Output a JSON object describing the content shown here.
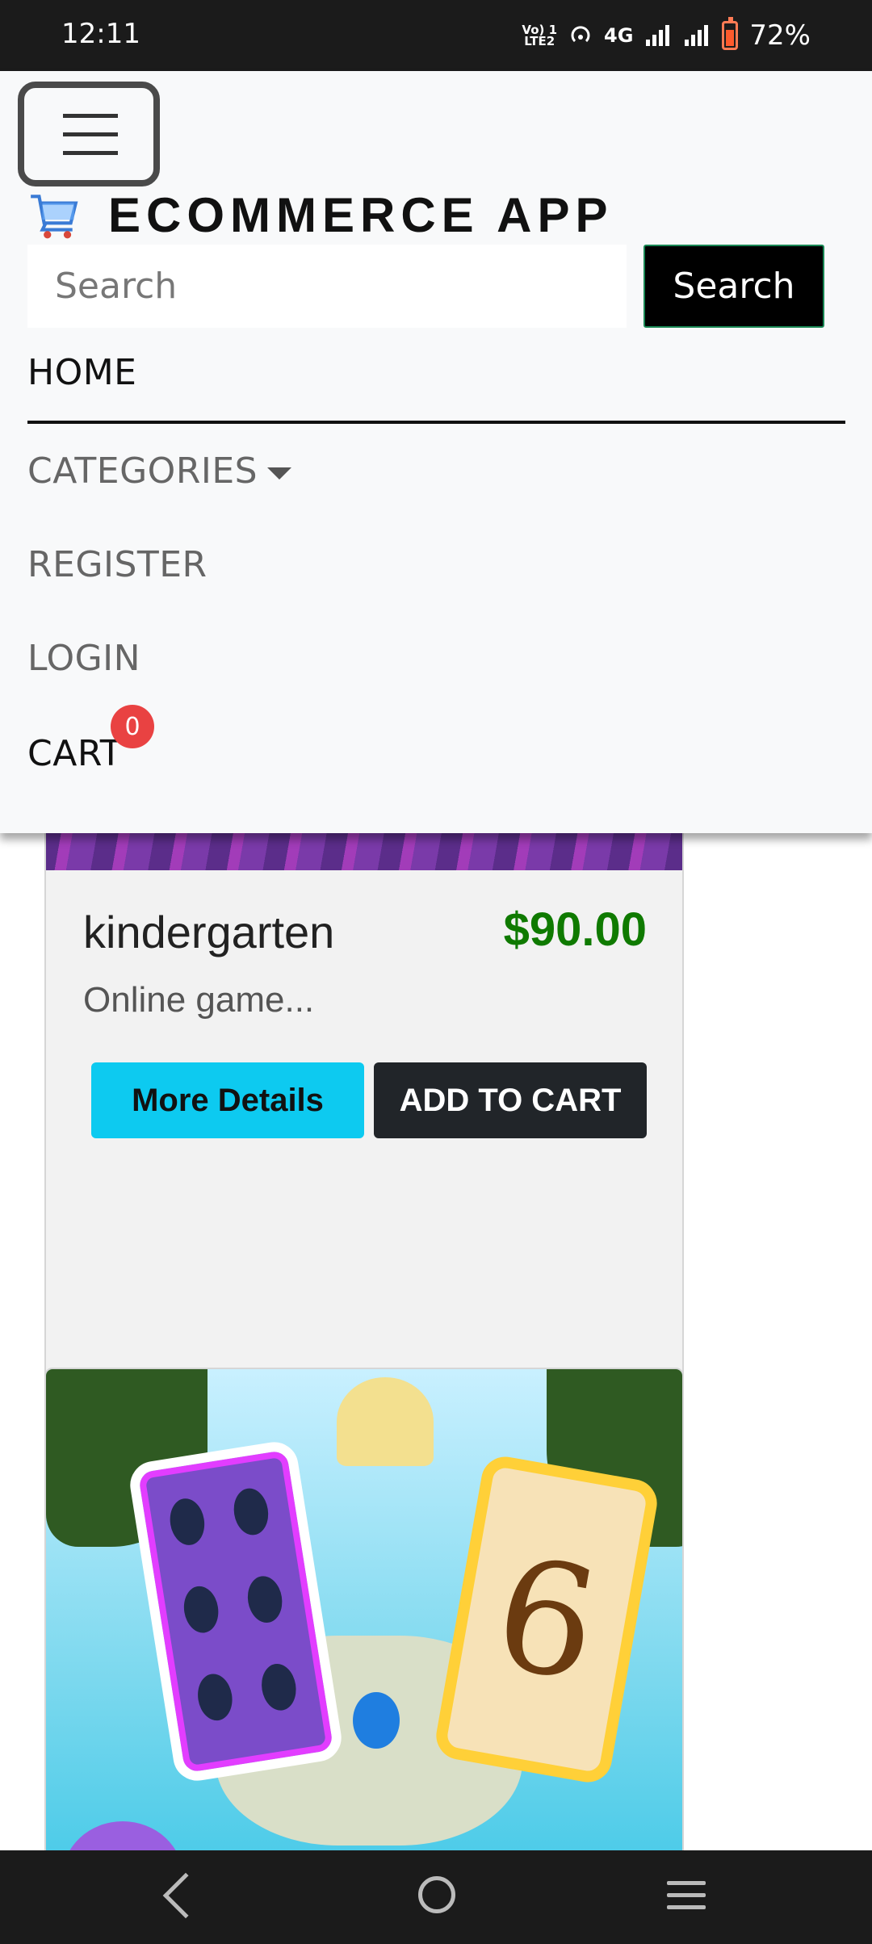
{
  "status_bar": {
    "time": "12:11",
    "network_top": "Vo) 1",
    "network_bottom": "LTE2",
    "mobile_data": "4G",
    "battery_percent": "72%"
  },
  "navbar": {
    "brand_title": "ECOMMERCE APP",
    "search": {
      "placeholder": "Search",
      "button_label": "Search"
    },
    "items": {
      "home": "HOME",
      "categories": "CATEGORIES",
      "register": "REGISTER",
      "login": "LOGIN",
      "cart": "CART"
    },
    "cart_count": "0"
  },
  "products": [
    {
      "name": "kindergarten",
      "price": "$90.00",
      "description": "Online game...",
      "more_details_label": "More Details",
      "add_to_cart_label": "ADD TO CART"
    }
  ],
  "colors": {
    "price": "#0f7a00",
    "more_details_bg": "#0dcaf0",
    "add_to_cart_bg": "#212529",
    "cart_badge": "#e94242",
    "search_button_border": "#198754"
  },
  "icons": {
    "menu": "hamburger-icon",
    "brand": "shopping-cart-icon",
    "back": "back-icon",
    "home": "home-circle-icon",
    "recent": "recent-apps-icon"
  }
}
